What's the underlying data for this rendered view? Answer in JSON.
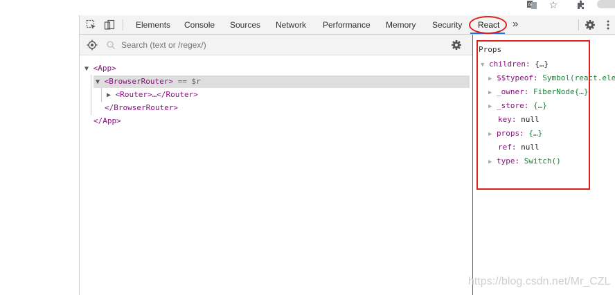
{
  "toolbar": {
    "tabs": [
      "Elements",
      "Console",
      "Sources",
      "Network",
      "Performance",
      "Memory",
      "Security",
      "React"
    ],
    "more": "»"
  },
  "search": {
    "placeholder": "Search (text or /regex/)"
  },
  "tree": {
    "app_open": "<App>",
    "router_open": "<BrowserRouter>",
    "router_suffix": "== $r",
    "router_child": "<Router>…</Router>",
    "router_close": "</BrowserRouter>",
    "app_close": "</App>"
  },
  "props": {
    "title": "Props",
    "children_key": "children:",
    "children_val": "{…}",
    "items": [
      {
        "key": "$$typeof:",
        "val": "Symbol(react.ele"
      },
      {
        "key": "_owner:",
        "val": "FiberNode{…}"
      },
      {
        "key": "_store:",
        "val": "{…}"
      },
      {
        "key": "key:",
        "val": "null"
      },
      {
        "key": "props:",
        "val": "{…}"
      },
      {
        "key": "ref:",
        "val": "null"
      },
      {
        "key": "type:",
        "val": "Switch()"
      }
    ]
  },
  "watermark": "https://blog.csdn.net/Mr_CZL",
  "colors": {
    "highlight": "#e22020",
    "tag": "#881280",
    "accent": "#1a73e8"
  }
}
